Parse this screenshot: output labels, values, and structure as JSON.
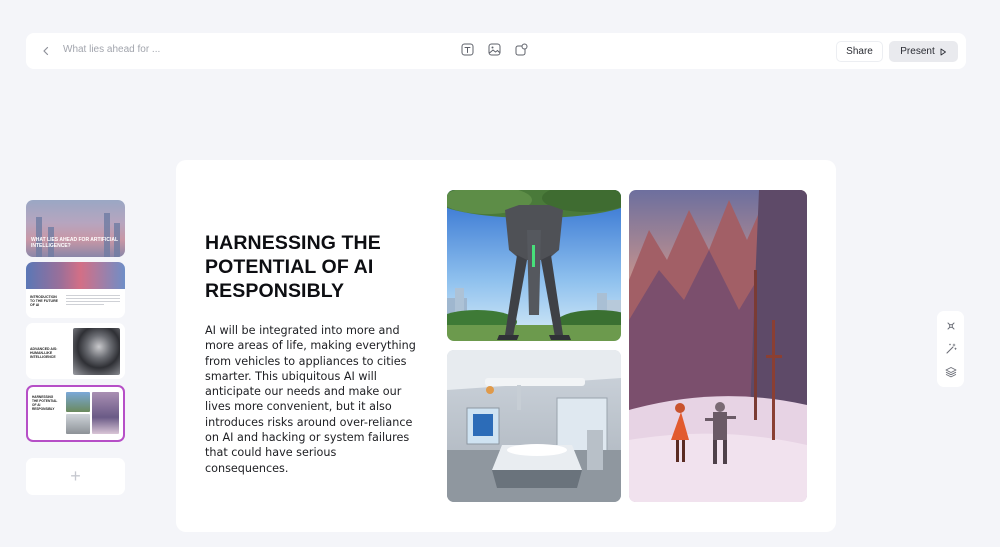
{
  "toolbar": {
    "title": "What lies ahead for ...",
    "share_label": "Share",
    "present_label": "Present",
    "tools": [
      "text-box-icon",
      "image-icon",
      "shapes-icon"
    ]
  },
  "thumbnails": [
    {
      "title": "What lies ahead for Artificial Intelligence?"
    },
    {
      "title": "Introduction to the future of AI"
    },
    {
      "title": "Advanced AIs: Human-like intelligence"
    },
    {
      "title": "Harnessing the potential of AI responsibly"
    }
  ],
  "add_slide_label": "+",
  "slide": {
    "title": "HARNESSING THE POTENTIAL OF AI RESPONSIBLY",
    "body": "AI will be integrated into more and more areas of life, making everything from vehicles to appliances to cities smarter. This ubiquitous AI will anticipate our needs and make our lives more convenient, but it also introduces risks around over-reliance on AI and hacking or system failures that could have serious consequences.",
    "images": [
      "giant-robot-city-image",
      "hospital-room-image",
      "desert-figures-image"
    ]
  },
  "side_tools": [
    "magic-cross-icon",
    "magic-wand-icon",
    "layers-icon"
  ],
  "colors": {
    "background": "#f4f5f9",
    "active_thumb_border": "#b64fc7"
  }
}
